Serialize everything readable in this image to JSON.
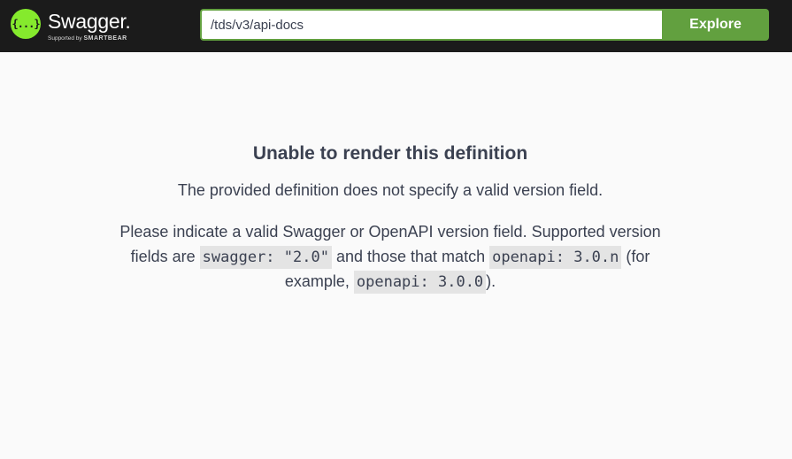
{
  "header": {
    "logo": {
      "glyph": "{...}",
      "name": "Swagger.",
      "tagline_prefix": "Supported by",
      "tagline_brand": "SMARTBEAR"
    },
    "url_input_value": "/tds/v3/api-docs",
    "explore_label": "Explore"
  },
  "error": {
    "title": "Unable to render this definition",
    "message": "The provided definition does not specify a valid version field.",
    "detail_part1": "Please indicate a valid Swagger or OpenAPI version field. Supported version fields are",
    "code_swagger": "swagger: \"2.0\"",
    "detail_part2": "and those that match",
    "code_openapi": "openapi: 3.0.n",
    "detail_part3": "(for example,",
    "code_example": "openapi: 3.0.0",
    "detail_part4": ")."
  },
  "colors": {
    "topbar": "#1b1b1b",
    "accent_green": "#62a03f",
    "logo_green": "#85ea2d",
    "text": "#3b4151",
    "code_bg": "#e4e4e4",
    "page_bg": "#fafafa"
  }
}
